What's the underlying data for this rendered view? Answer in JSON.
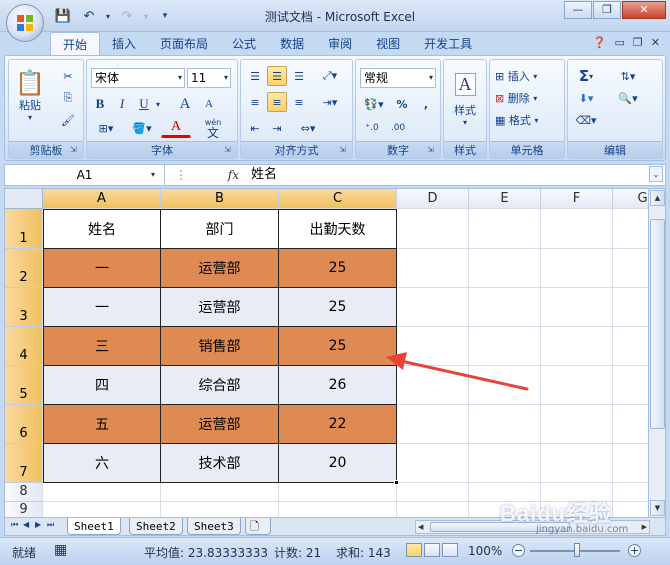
{
  "window": {
    "title": "测试文档 - Microsoft Excel"
  },
  "tabs": [
    {
      "label": "开始",
      "active": true
    },
    {
      "label": "插入"
    },
    {
      "label": "页面布局"
    },
    {
      "label": "公式"
    },
    {
      "label": "数据"
    },
    {
      "label": "审阅"
    },
    {
      "label": "视图"
    },
    {
      "label": "开发工具"
    }
  ],
  "ribbon": {
    "clipboard": {
      "label": "剪贴板",
      "paste": "粘贴"
    },
    "font": {
      "label": "字体",
      "name": "宋体",
      "size": "11",
      "bold": "B",
      "italic": "I",
      "underline": "U",
      "grow": "A",
      "shrink": "A",
      "color_letter": "A",
      "wen": "wén",
      "wen_char": "文"
    },
    "alignment": {
      "label": "对齐方式"
    },
    "number": {
      "label": "数字",
      "format": "常规",
      "percent": "%",
      "comma": ","
    },
    "styles": {
      "label": "样式",
      "style_button": "样式"
    },
    "cells": {
      "label": "单元格",
      "insert": "插入",
      "delete": "删除",
      "format": "格式"
    },
    "editing": {
      "label": "编辑",
      "sum": "Σ"
    }
  },
  "formula_bar": {
    "name_box": "A1",
    "fx": "fx",
    "content": "姓名"
  },
  "grid": {
    "columns": [
      "A",
      "B",
      "C",
      "D",
      "E",
      "F",
      "G"
    ],
    "rows": [
      "1",
      "2",
      "3",
      "4",
      "5",
      "6",
      "7",
      "8",
      "9"
    ],
    "table": [
      {
        "cells": [
          "姓名",
          "部门",
          "出勤天数"
        ],
        "fill": "white"
      },
      {
        "cells": [
          "一",
          "运营部",
          "25"
        ],
        "fill": "orange"
      },
      {
        "cells": [
          "一",
          "运营部",
          "25"
        ],
        "fill": "light"
      },
      {
        "cells": [
          "三",
          "销售部",
          "25"
        ],
        "fill": "orange"
      },
      {
        "cells": [
          "四",
          "综合部",
          "26"
        ],
        "fill": "light"
      },
      {
        "cells": [
          "五",
          "运营部",
          "22"
        ],
        "fill": "orange"
      },
      {
        "cells": [
          "六",
          "技术部",
          "20"
        ],
        "fill": "light"
      }
    ],
    "colors": {
      "orange": "#de8a52",
      "light": "#e8ecf5",
      "white": "#ffffff",
      "arrow": "#e8443a"
    }
  },
  "sheets": [
    {
      "label": "Sheet1",
      "active": true
    },
    {
      "label": "Sheet2"
    },
    {
      "label": "Sheet3"
    }
  ],
  "status": {
    "mode": "就绪",
    "average": "平均值: 23.83333333",
    "count": "计数: 21",
    "sum": "求和: 143",
    "zoom": "100%",
    "zoom_minus": "−",
    "zoom_plus": "+"
  },
  "watermark": {
    "main": "Baidu经验",
    "sub": "jingyan.baidu.com"
  }
}
